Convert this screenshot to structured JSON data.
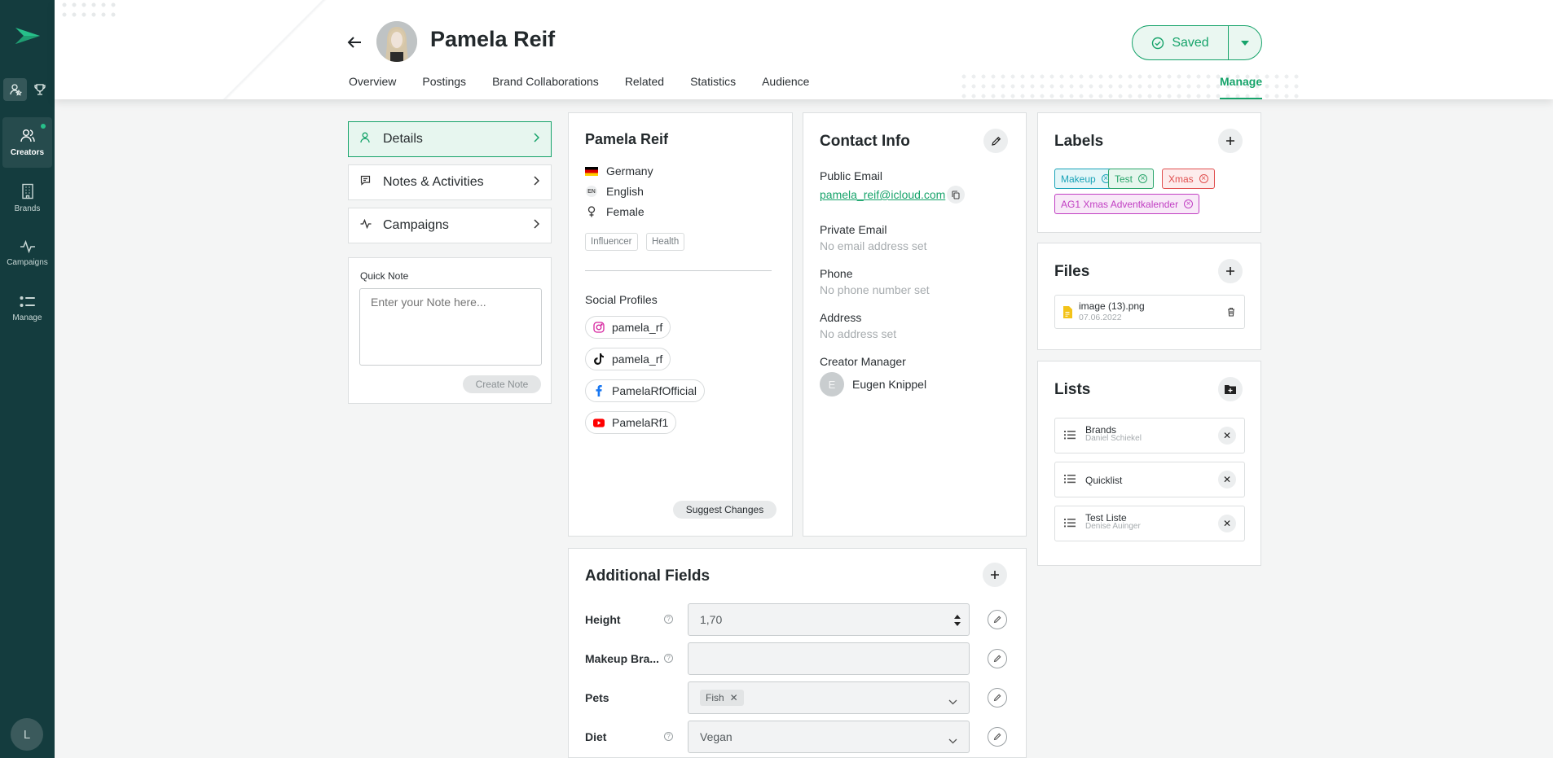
{
  "sidebar": {
    "nav": [
      {
        "label": "Creators",
        "icon": "creators-icon"
      },
      {
        "label": "Brands",
        "icon": "building-icon"
      },
      {
        "label": "Campaigns",
        "icon": "pulse-icon"
      },
      {
        "label": "Manage",
        "icon": "list-icon"
      }
    ],
    "user_initial": "L"
  },
  "header": {
    "name": "Pamela Reif",
    "tabs": [
      "Overview",
      "Postings",
      "Brand Collaborations",
      "Related",
      "Statistics",
      "Audience"
    ],
    "active_tab": "Manage",
    "saved_label": "Saved"
  },
  "menu": {
    "items": [
      "Details",
      "Notes & Activities",
      "Campaigns"
    ]
  },
  "quick_note": {
    "title": "Quick Note",
    "placeholder": "Enter your Note here...",
    "button": "Create Note"
  },
  "creator": {
    "name": "Pamela Reif",
    "country": "Germany",
    "language": "English",
    "language_code": "EN",
    "gender": "Female",
    "tags": [
      "Influencer",
      "Health"
    ],
    "social_title": "Social Profiles",
    "socials": [
      {
        "platform": "instagram",
        "handle": "pamela_rf"
      },
      {
        "platform": "tiktok",
        "handle": "pamela_rf"
      },
      {
        "platform": "facebook",
        "handle": "PamelaRfOfficial"
      },
      {
        "platform": "youtube",
        "handle": "PamelaRf1"
      }
    ],
    "suggest_button": "Suggest Changes"
  },
  "contact": {
    "title": "Contact Info",
    "public_email_label": "Public Email",
    "public_email": "pamela_reif@icloud.com",
    "private_email_label": "Private Email",
    "private_email": "No email address set",
    "phone_label": "Phone",
    "phone": "No phone number set",
    "address_label": "Address",
    "address": "No address set",
    "manager_label": "Creator Manager",
    "manager_initial": "E",
    "manager_name": "Eugen Knippel"
  },
  "labels": {
    "title": "Labels",
    "items": [
      {
        "text": "Makeup",
        "color": "#1aa3b8",
        "bg": "#e4f6f8"
      },
      {
        "text": "Test",
        "color": "#2aa56b",
        "bg": "#e6f6ed"
      },
      {
        "text": "Xmas",
        "color": "#e04f4f",
        "bg": "#fdecec"
      },
      {
        "text": "AG1 Xmas Adventkalender",
        "color": "#c13fc3",
        "bg": "#f8e9f8"
      }
    ]
  },
  "files": {
    "title": "Files",
    "items": [
      {
        "name": "image (13).png",
        "date": "07.06.2022"
      }
    ]
  },
  "lists": {
    "title": "Lists",
    "items": [
      {
        "name": "Brands",
        "owner": "Daniel Schiekel"
      },
      {
        "name": "Quicklist",
        "owner": ""
      },
      {
        "name": "Test Liste",
        "owner": "Denise Auinger"
      }
    ]
  },
  "additional": {
    "title": "Additional Fields",
    "fields": [
      {
        "label": "Height",
        "value": "1,70"
      },
      {
        "label": "Makeup Bra...",
        "value": ""
      },
      {
        "label": "Pets",
        "value": "Fish"
      },
      {
        "label": "Diet",
        "value": "Vegan"
      }
    ]
  },
  "colors": {
    "accent": "#16a36a",
    "sidebar": "#143c3e"
  }
}
